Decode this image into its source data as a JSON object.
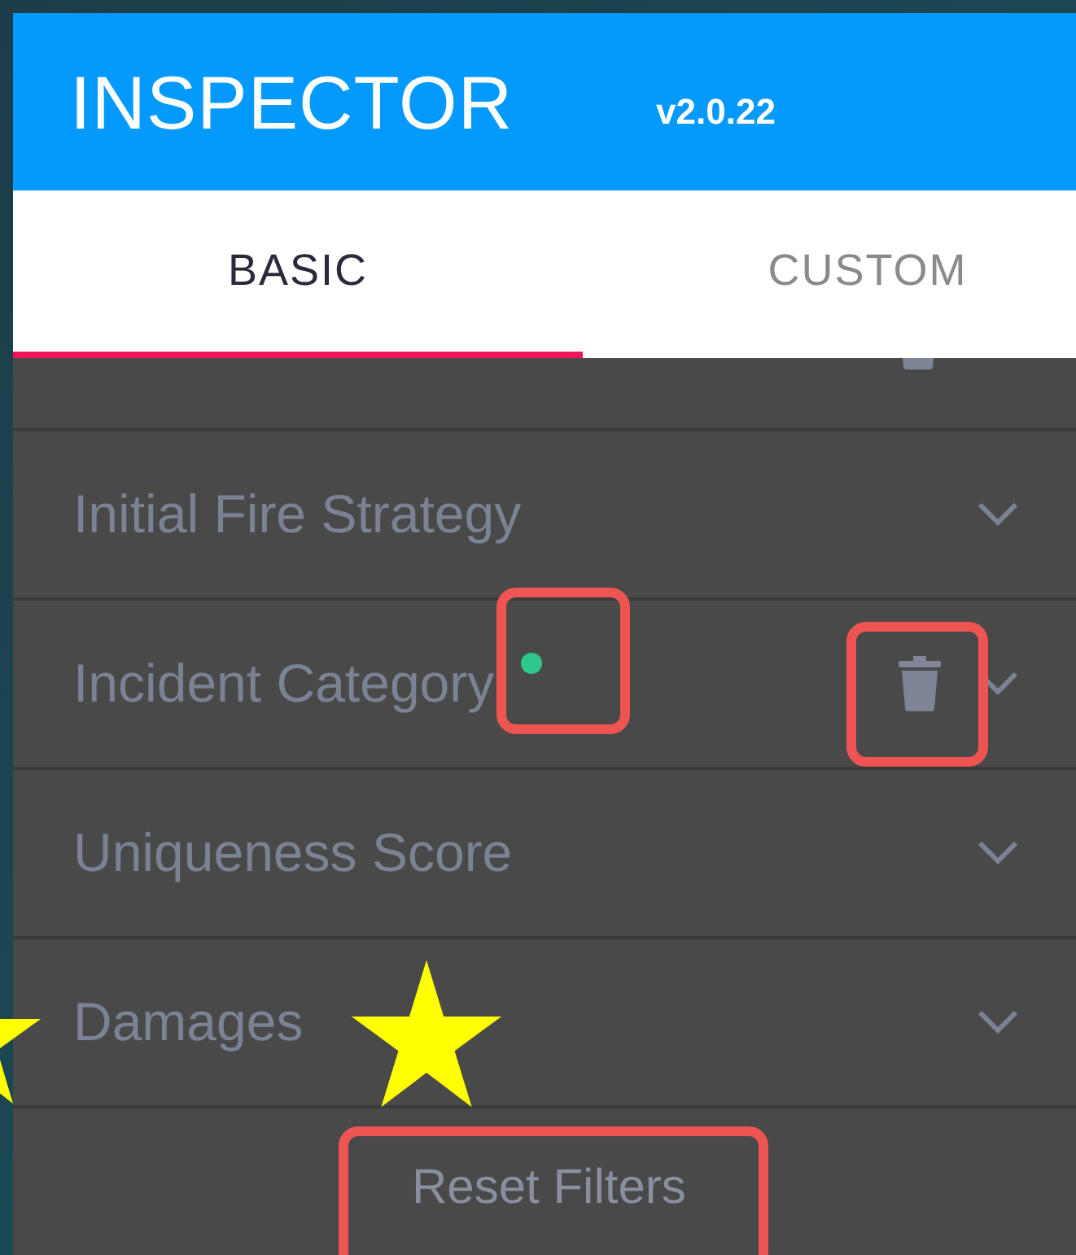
{
  "header": {
    "title": "INSPECTOR",
    "version": "v2.0.22"
  },
  "tabs": [
    {
      "label": "BASIC",
      "selected": true
    },
    {
      "label": "CUSTOM",
      "selected": false
    }
  ],
  "clipped_row": {
    "active": true
  },
  "filters": [
    {
      "label": "Initial Fire Strategy",
      "active": false
    },
    {
      "label": "Incident Category",
      "active": true
    },
    {
      "label": "Uniqueness Score",
      "active": false
    },
    {
      "label": "Damages",
      "active": false
    }
  ],
  "reset_button": {
    "label": "Reset Filters"
  }
}
